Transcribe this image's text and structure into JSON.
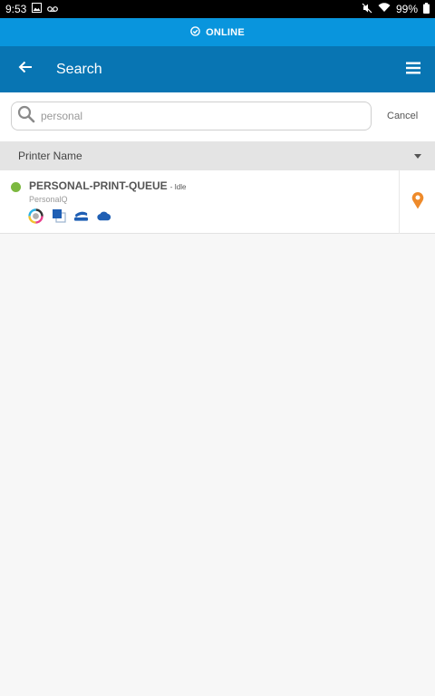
{
  "status_bar": {
    "time": "9:53",
    "battery": "99%",
    "left_icons": [
      "image-icon",
      "voicemail-icon"
    ],
    "right_icons": [
      "mute-icon",
      "wifi-icon",
      "battery-icon"
    ]
  },
  "connection": {
    "label": "ONLINE",
    "icon": "check-circle-icon",
    "color": "#0995dd"
  },
  "toolbar": {
    "title": "Search",
    "back_icon": "arrow-left-icon",
    "menu_icon": "hamburger-menu-icon",
    "color": "#0875b3"
  },
  "search": {
    "value": "personal",
    "icon": "search-icon",
    "cancel_label": "Cancel"
  },
  "sort": {
    "label": "Printer Name",
    "icon": "caret-down-icon"
  },
  "printers": [
    {
      "name": "PERSONAL-PRINT-QUEUE",
      "status": "- Idle",
      "status_color": "#7cb83f",
      "subtitle": "PersonalQ",
      "features": [
        "color-print-icon",
        "duplex-icon",
        "staple-icon",
        "cloud-icon"
      ],
      "action_icon": "map-pin-icon",
      "action_color": "#ee8a2a"
    }
  ]
}
